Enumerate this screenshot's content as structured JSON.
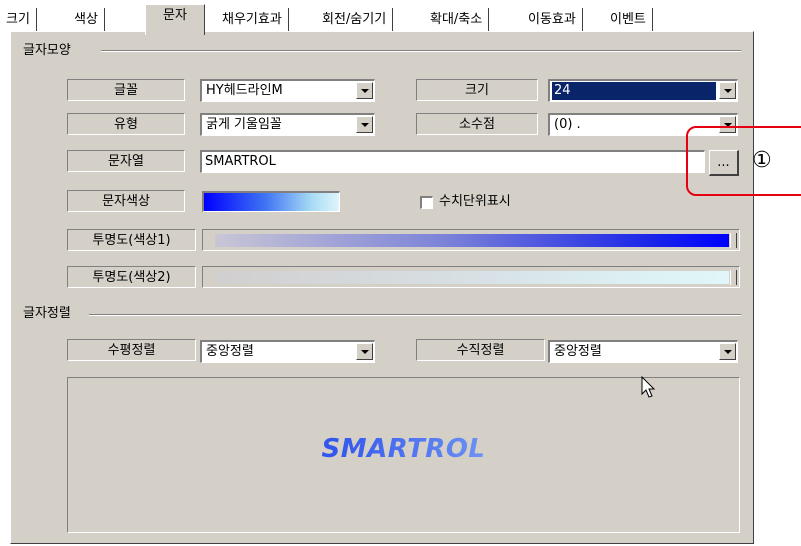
{
  "tabs": [
    {
      "label": "크기"
    },
    {
      "label": "색상"
    },
    {
      "label": "문자"
    },
    {
      "label": "채우기효과"
    },
    {
      "label": "회전/숨기기"
    },
    {
      "label": "확대/축소"
    },
    {
      "label": "이동효과"
    },
    {
      "label": "이벤트"
    }
  ],
  "font_group": {
    "title": "글자모양",
    "font_label": "글꼴",
    "font_value": "HY헤드라인M",
    "size_label": "크기",
    "size_value": "24",
    "style_label": "유형",
    "style_value": "굵게 기울임꼴",
    "decimal_label": "소수점",
    "decimal_value": "(0) .",
    "string_label": "문자열",
    "string_value": "SMARTROL",
    "browse_label": "...",
    "color_label": "문자색상",
    "unit_checkbox_label": "수치단위표시",
    "alpha1_label": "투명도(색상1)",
    "alpha2_label": "투명도(색상2)"
  },
  "align_group": {
    "title": "글자정렬",
    "h_label": "수평정렬",
    "h_value": "중앙정렬",
    "v_label": "수직정렬",
    "v_value": "중앙정렬"
  },
  "preview": {
    "text": "SMARTROL"
  },
  "callout": {
    "number": "①"
  },
  "colors": {
    "dialog_bg": "#d4d0c8",
    "text_color_start": "#0000ff",
    "text_color_end": "#e0f4fb",
    "callout": "#e60012"
  }
}
